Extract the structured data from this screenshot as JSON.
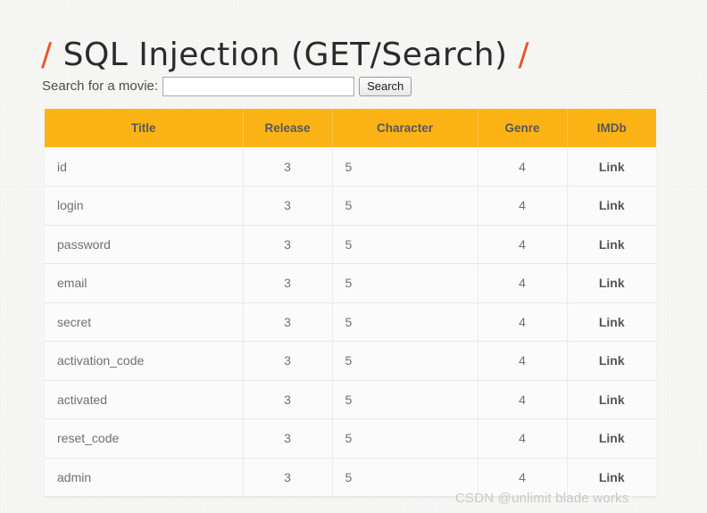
{
  "page": {
    "title_prefix": "/",
    "title_text": "SQL Injection (GET/Search)",
    "title_suffix": "/",
    "accent_color": "#ea5524",
    "header_bg_color": "#fcb316",
    "background_color": "#f7f7f6"
  },
  "search": {
    "label": "Search for a movie:",
    "value": "",
    "placeholder": "",
    "button_label": "Search"
  },
  "table": {
    "columns": [
      {
        "key": "title",
        "label": "Title"
      },
      {
        "key": "release",
        "label": "Release"
      },
      {
        "key": "character",
        "label": "Character"
      },
      {
        "key": "genre",
        "label": "Genre"
      },
      {
        "key": "imdb",
        "label": "IMDb"
      }
    ],
    "rows": [
      {
        "title": "id",
        "release": "3",
        "character": "5",
        "genre": "4",
        "imdb": "Link"
      },
      {
        "title": "login",
        "release": "3",
        "character": "5",
        "genre": "4",
        "imdb": "Link"
      },
      {
        "title": "password",
        "release": "3",
        "character": "5",
        "genre": "4",
        "imdb": "Link"
      },
      {
        "title": "email",
        "release": "3",
        "character": "5",
        "genre": "4",
        "imdb": "Link"
      },
      {
        "title": "secret",
        "release": "3",
        "character": "5",
        "genre": "4",
        "imdb": "Link"
      },
      {
        "title": "activation_code",
        "release": "3",
        "character": "5",
        "genre": "4",
        "imdb": "Link"
      },
      {
        "title": "activated",
        "release": "3",
        "character": "5",
        "genre": "4",
        "imdb": "Link"
      },
      {
        "title": "reset_code",
        "release": "3",
        "character": "5",
        "genre": "4",
        "imdb": "Link"
      },
      {
        "title": "admin",
        "release": "3",
        "character": "5",
        "genre": "4",
        "imdb": "Link"
      }
    ]
  },
  "watermark": {
    "text": "CSDN @unlimit blade works"
  }
}
